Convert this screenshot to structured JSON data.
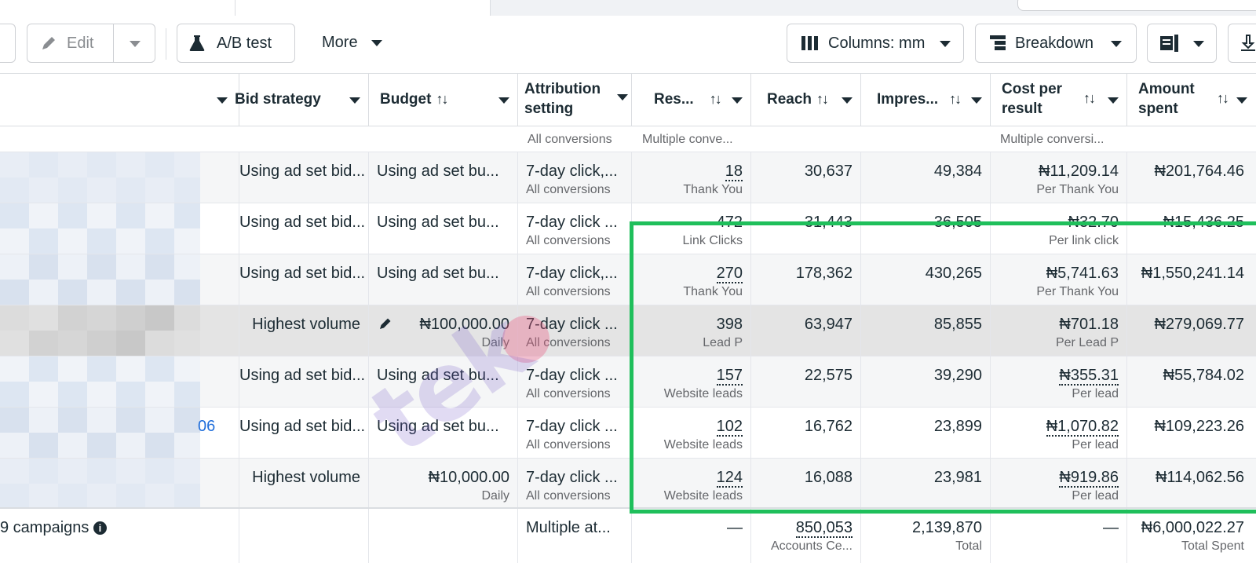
{
  "toolbar": {
    "edit_label": "Edit",
    "ab_test_label": "A/B test",
    "more_label": "More",
    "columns_label": "Columns: mm",
    "breakdown_label": "Breakdown"
  },
  "columns": {
    "bid_strategy": "Bid strategy",
    "budget": "Budget",
    "attribution_line1": "Attribution",
    "attribution_line2": "setting",
    "results": "Res...",
    "reach": "Reach",
    "impressions": "Impres...",
    "cost_line1": "Cost per",
    "cost_line2": "result",
    "amount_line1": "Amount",
    "amount_line2": "spent"
  },
  "top_partial_row": {
    "attribution_sub": "All conversions",
    "results_sub": "Multiple conve...",
    "cost_sub": "Multiple conversi..."
  },
  "rows": [
    {
      "bid": "Using ad set bid...",
      "budget": "Using ad set bu...",
      "budget_sub": "",
      "attr": "7-day click,...",
      "attr_sub": "All conversions",
      "results": "18",
      "results_sub": "Thank You",
      "reach": "30,637",
      "impressions": "49,384",
      "cost": "₦11,209.14",
      "cost_sub": "Per Thank You",
      "amount": "₦201,764.46",
      "name_suffix": ""
    },
    {
      "bid": "Using ad set bid...",
      "budget": "Using ad set bu...",
      "budget_sub": "",
      "attr": "7-day click ...",
      "attr_sub": "All conversions",
      "results": "472",
      "results_sub": "Link Clicks",
      "reach": "31,443",
      "impressions": "36,505",
      "cost": "₦32.70",
      "cost_sub": "Per link click",
      "amount": "₦15,436.25",
      "name_suffix": ""
    },
    {
      "bid": "Using ad set bid...",
      "budget": "Using ad set bu...",
      "budget_sub": "",
      "attr": "7-day click,...",
      "attr_sub": "All conversions",
      "results": "270",
      "results_sub": "Thank You",
      "reach": "178,362",
      "impressions": "430,265",
      "cost": "₦5,741.63",
      "cost_sub": "Per Thank You",
      "amount": "₦1,550,241.14",
      "name_suffix": ""
    },
    {
      "bid": "Highest volume",
      "budget": "₦100,000.00",
      "budget_sub": "Daily",
      "attr": "7-day click ...",
      "attr_sub": "All conversions",
      "results": "398",
      "results_sub": "Lead P",
      "reach": "63,947",
      "impressions": "85,855",
      "cost": "₦701.18",
      "cost_sub": "Per Lead P",
      "amount": "₦279,069.77",
      "name_suffix": ""
    },
    {
      "bid": "Using ad set bid...",
      "budget": "Using ad set bu...",
      "budget_sub": "",
      "attr": "7-day click ...",
      "attr_sub": "All conversions",
      "results": "157",
      "results_sub": "Website leads",
      "reach": "22,575",
      "impressions": "39,290",
      "cost": "₦355.31",
      "cost_sub": "Per lead",
      "amount": "₦55,784.02",
      "name_suffix": ""
    },
    {
      "bid": "Using ad set bid...",
      "budget": "Using ad set bu...",
      "budget_sub": "",
      "attr": "7-day click ...",
      "attr_sub": "All conversions",
      "results": "102",
      "results_sub": "Website leads",
      "reach": "16,762",
      "impressions": "23,899",
      "cost": "₦1,070.82",
      "cost_sub": "Per lead",
      "amount": "₦109,223.26",
      "name_suffix": "06"
    },
    {
      "bid": "Highest volume",
      "budget": "₦10,000.00",
      "budget_sub": "Daily",
      "attr": "7-day click ...",
      "attr_sub": "All conversions",
      "results": "124",
      "results_sub": "Website leads",
      "reach": "16,088",
      "impressions": "23,981",
      "cost": "₦919.86",
      "cost_sub": "Per lead",
      "amount": "₦114,062.56",
      "name_suffix": ""
    }
  ],
  "totals": {
    "label": "9 campaigns",
    "attribution": "Multiple at...",
    "results": "—",
    "reach": "850,053",
    "reach_sub": "Accounts Ce...",
    "impressions": "2,139,870",
    "impressions_sub": "Total",
    "cost": "—",
    "amount": "₦6,000,022.27",
    "amount_sub": "Total Spent"
  },
  "watermark": "tek",
  "colors": {
    "highlight_frame": "#1fbf5b",
    "link": "#216fdb"
  }
}
